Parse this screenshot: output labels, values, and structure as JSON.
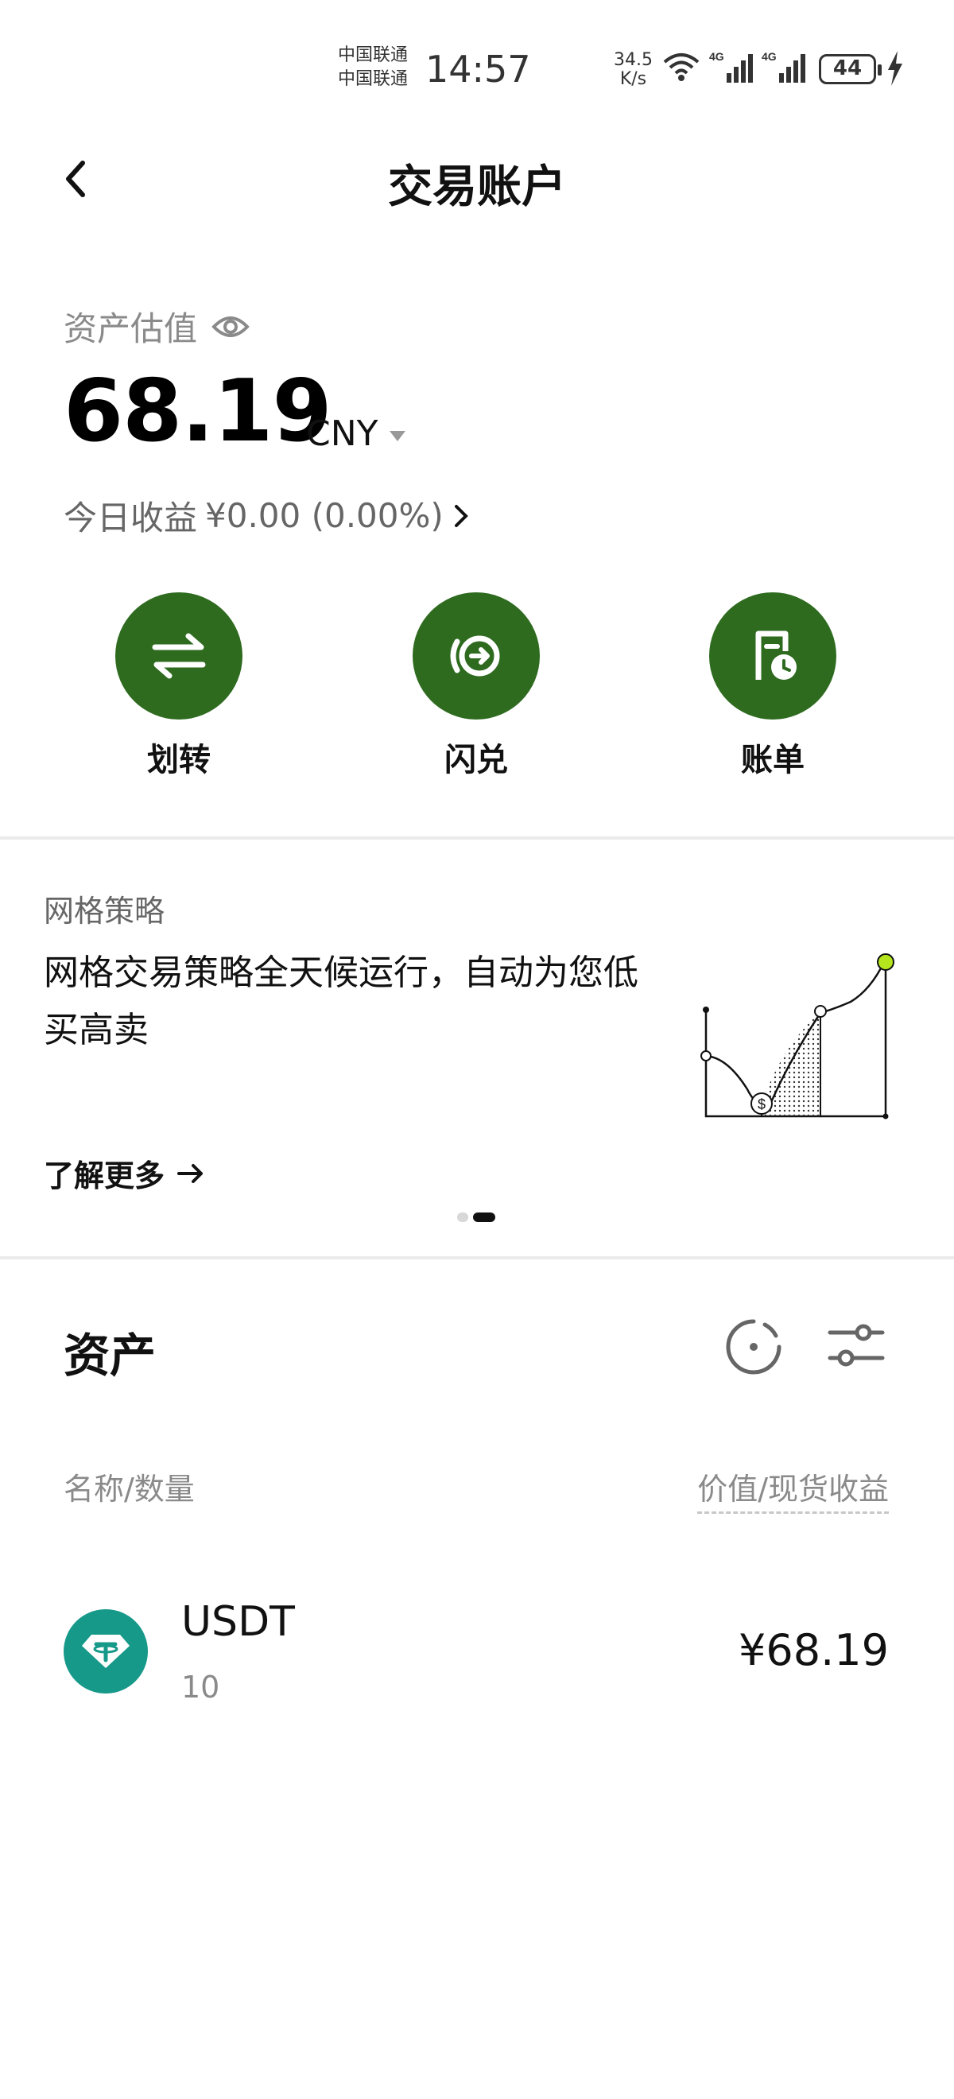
{
  "status_bar": {
    "carrier_1": "中国联通",
    "carrier_2": "中国联通",
    "time": "14:57",
    "net_speed_value": "34.5",
    "net_speed_unit": "K/s",
    "battery": "44"
  },
  "header": {
    "title": "交易账户"
  },
  "summary": {
    "label": "资产估值",
    "amount": "68.19",
    "currency": "CNY",
    "today_label": "今日收益",
    "today_value": "¥0.00 (0.00%)"
  },
  "actions": [
    {
      "label": "划转",
      "icon": "transfer-icon"
    },
    {
      "label": "闪兑",
      "icon": "flash-convert-icon"
    },
    {
      "label": "账单",
      "icon": "bill-icon"
    }
  ],
  "banner": {
    "tag": "网格策略",
    "text": "网格交易策略全天候运行，自动为您低买高卖",
    "more": "了解更多",
    "page_index": 2,
    "page_count": 2
  },
  "assets": {
    "title": "资产",
    "col_left": "名称/数量",
    "col_right": "价值/现货收益",
    "items": [
      {
        "name": "USDT",
        "quantity": "10",
        "value": "¥68.19"
      }
    ]
  },
  "colors": {
    "accent_green": "#2e6b1f",
    "usdt_teal": "#17998a",
    "chart_highlight": "#b5e61d"
  }
}
